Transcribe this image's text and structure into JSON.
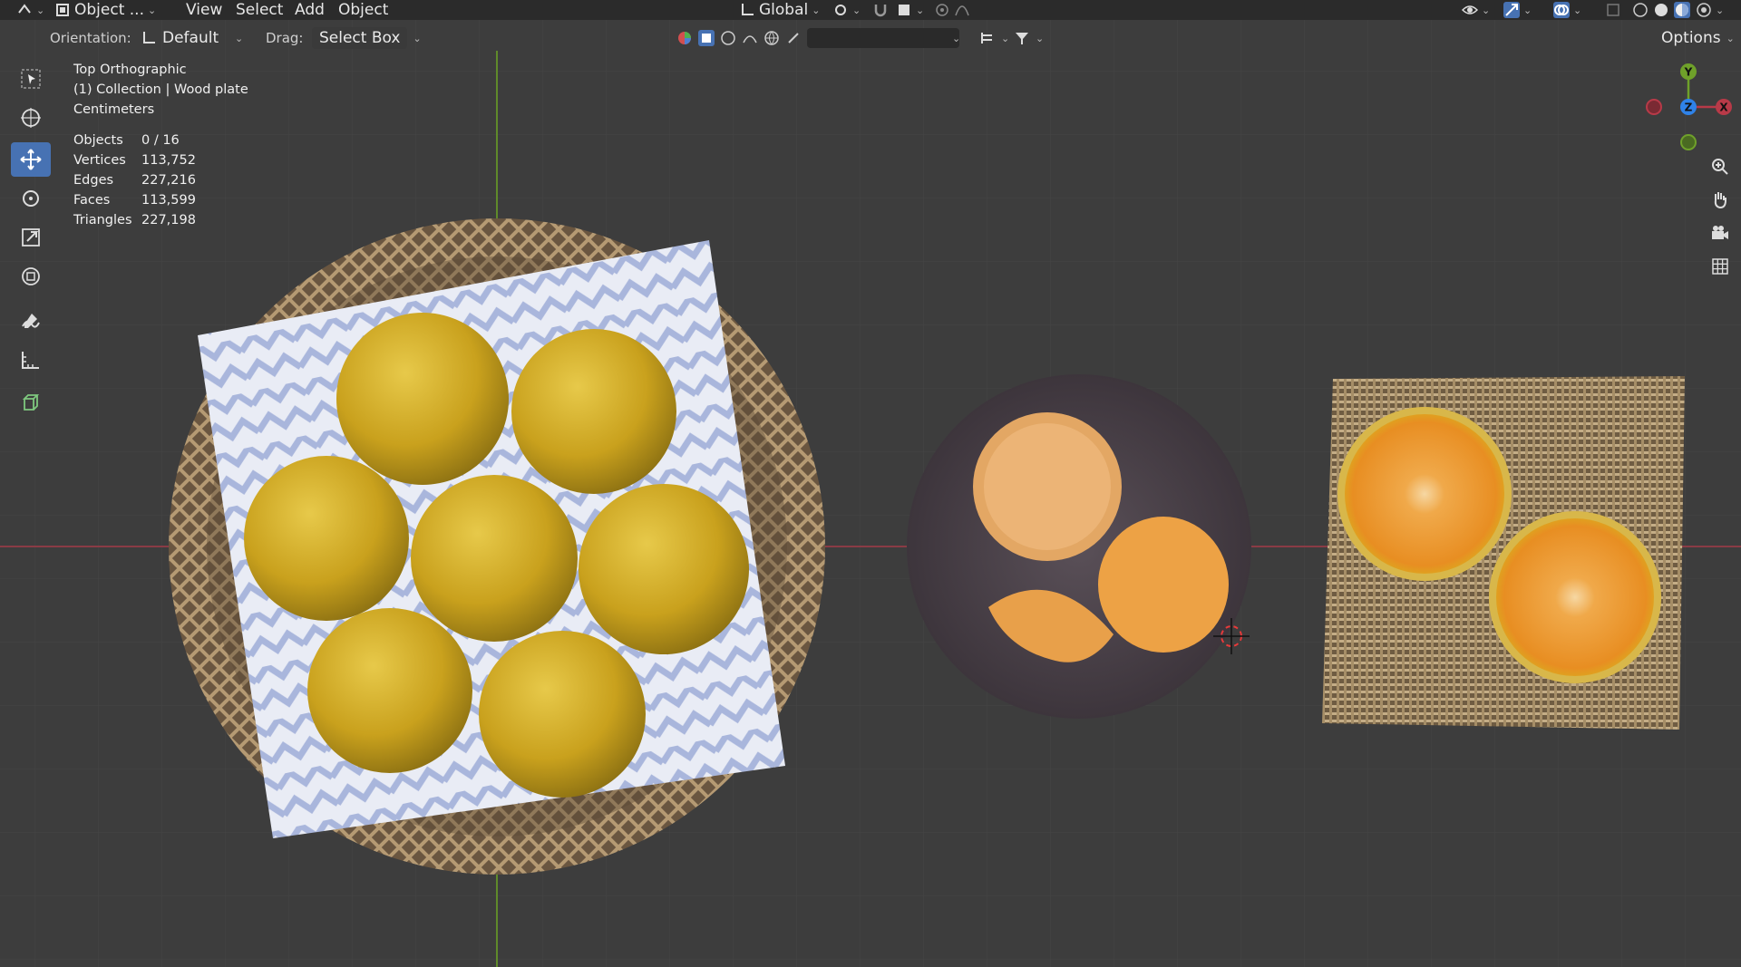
{
  "header": {
    "mode_label": "Object ...",
    "menus": [
      "View",
      "Select",
      "Add",
      "Object"
    ],
    "transform_orientation": "Global"
  },
  "tool_settings": {
    "orientation_label": "Orientation:",
    "orientation_value": "Default",
    "drag_label": "Drag:",
    "drag_value": "Select Box",
    "options_label": "Options"
  },
  "viewport": {
    "view_name": "Top Orthographic",
    "collection": "(1) Collection | Wood plate",
    "units": "Centimeters",
    "stats": [
      {
        "label": "Objects",
        "value": "0 / 16"
      },
      {
        "label": "Vertices",
        "value": "113,752"
      },
      {
        "label": "Edges",
        "value": "227,216"
      },
      {
        "label": "Faces",
        "value": "113,599"
      },
      {
        "label": "Triangles",
        "value": "227,198"
      }
    ]
  },
  "gizmo": {
    "x": "X",
    "y": "Y",
    "z": "Z"
  },
  "colors": {
    "x_axis": "#b83a48",
    "y_axis": "#6fa12a",
    "z_axis": "#2f82e8",
    "active_tool": "#4772b3",
    "grid_bg": "#3d3d3d"
  },
  "icons": {
    "tools": [
      "select-box-icon",
      "cursor-icon",
      "move-icon",
      "rotate-icon",
      "scale-icon",
      "transform-icon",
      "annotate-icon",
      "measure-icon",
      "add-cube-icon"
    ],
    "nav": [
      "zoom-icon",
      "pan-hand-icon",
      "camera-icon",
      "grid-icon"
    ]
  }
}
